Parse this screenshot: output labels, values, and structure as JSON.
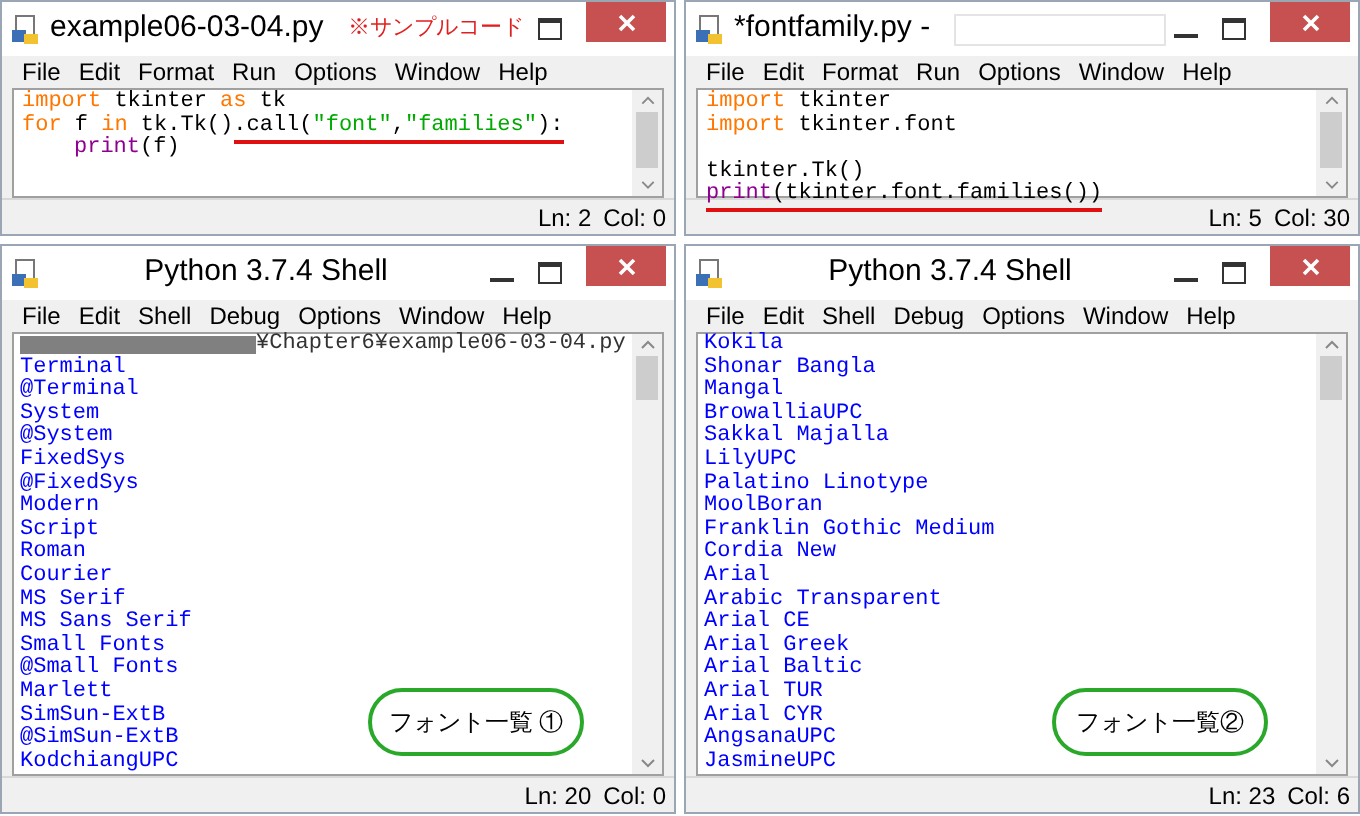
{
  "windows": [
    {
      "kind": "editor",
      "title": "example06-03-04.py",
      "note": "※サンプルコード",
      "menu": [
        "File",
        "Edit",
        "Format",
        "Run",
        "Options",
        "Window",
        "Help"
      ],
      "lines": [
        {
          "kind": "code",
          "tokens": [
            {
              "kind": "keyword",
              "text": "import"
            },
            {
              "kind": "plain",
              "text": " tkinter "
            },
            {
              "kind": "keyword",
              "text": "as"
            },
            {
              "kind": "plain",
              "text": " tk"
            }
          ]
        },
        {
          "kind": "code",
          "tokens": [
            {
              "kind": "keyword",
              "text": "for"
            },
            {
              "kind": "plain",
              "text": " f "
            },
            {
              "kind": "keyword",
              "text": "in"
            },
            {
              "kind": "plain",
              "text": " tk.Tk()"
            }
          ],
          "underlined": [
            {
              "kind": "plain",
              "text": ".call("
            },
            {
              "kind": "string",
              "text": "\"font\""
            },
            {
              "kind": "plain",
              "text": ","
            },
            {
              "kind": "string",
              "text": "\"families\""
            },
            {
              "kind": "plain",
              "text": "):"
            }
          ]
        },
        {
          "kind": "code",
          "indented": true,
          "tokens": [
            {
              "kind": "builtin",
              "text": "print"
            },
            {
              "kind": "plain",
              "text": "(f)"
            }
          ]
        }
      ],
      "status": [
        "Ln: 2",
        "Col: 0"
      ]
    },
    {
      "kind": "editor",
      "title": "*fontfamily.py -",
      "redacted_title": true,
      "menu": [
        "File",
        "Edit",
        "Format",
        "Run",
        "Options",
        "Window",
        "Help"
      ],
      "lines": [
        {
          "kind": "code",
          "tokens": [
            {
              "kind": "keyword",
              "text": "import"
            },
            {
              "kind": "plain",
              "text": " tkinter"
            }
          ]
        },
        {
          "kind": "code",
          "tokens": [
            {
              "kind": "keyword",
              "text": "import"
            },
            {
              "kind": "plain",
              "text": " tkinter.font"
            }
          ]
        },
        {
          "kind": "blank"
        },
        {
          "kind": "code",
          "tokens": [
            {
              "kind": "plain",
              "text": "tkinter.Tk()"
            }
          ]
        },
        {
          "kind": "code",
          "underlined": [
            {
              "kind": "builtin",
              "text": "print"
            },
            {
              "kind": "plain",
              "text": "(tkinter.font.families())"
            }
          ]
        }
      ],
      "status": [
        "Ln: 5",
        "Col: 30"
      ]
    },
    {
      "kind": "shell",
      "title": "Python 3.7.4 Shell",
      "menu": [
        "File",
        "Edit",
        "Shell",
        "Debug",
        "Options",
        "Window",
        "Help"
      ],
      "path_line": "¥Chapter6¥example06-03-04.py",
      "output": [
        "Terminal",
        "@Terminal",
        "System",
        "@System",
        "FixedSys",
        "@FixedSys",
        "Modern",
        "Script",
        "Roman",
        "Courier",
        "MS Serif",
        "MS Sans Serif",
        "Small Fonts",
        "@Small Fonts",
        "Marlett",
        "SimSun-ExtB",
        "@SimSun-ExtB",
        "KodchiangUPC"
      ],
      "callout": "フォント一覧 ①",
      "status": [
        "Ln: 20",
        "Col: 0"
      ]
    },
    {
      "kind": "shell",
      "title": "Python 3.7.4 Shell",
      "menu": [
        "File",
        "Edit",
        "Shell",
        "Debug",
        "Options",
        "Window",
        "Help"
      ],
      "output": [
        "Kokila",
        "Shonar Bangla",
        "Mangal",
        "BrowalliaUPC",
        "Sakkal Majalla",
        "LilyUPC",
        "Palatino Linotype",
        "MoolBoran",
        "Franklin Gothic Medium",
        "Cordia New",
        "Arial",
        "Arabic Transparent",
        "Arial CE",
        "Arial Greek",
        "Arial Baltic",
        "Arial TUR",
        "Arial CYR",
        "AngsanaUPC",
        "JasmineUPC"
      ],
      "callout": "フォント一覧②",
      "status": [
        "Ln: 23",
        "Col: 6"
      ]
    }
  ]
}
